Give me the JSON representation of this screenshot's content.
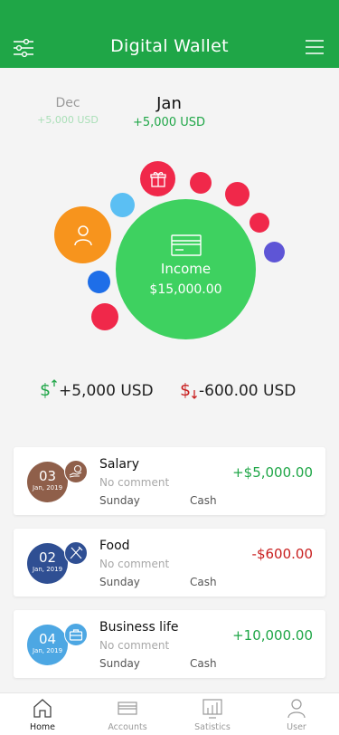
{
  "header": {
    "title": "Digital Wallet"
  },
  "months": {
    "prev": {
      "name": "Dec",
      "amount": "+5,000 USD"
    },
    "current": {
      "name": "Jan",
      "amount": "+5,000 USD"
    }
  },
  "main_bubble": {
    "label": "Income",
    "value": "$15,000.00"
  },
  "summary": {
    "income": "+5,000 USD",
    "expense": "-600.00 USD"
  },
  "transactions": [
    {
      "day": "03",
      "date_sub": "Jan, 2019",
      "category": "Salary",
      "comment": "No comment",
      "weekday": "Sunday",
      "method": "Cash",
      "amount": "+$5,000.00",
      "color": "#8f5f4a",
      "icon": "money-hand-icon",
      "amount_color": "#1fa647"
    },
    {
      "day": "02",
      "date_sub": "Jan, 2019",
      "category": "Food",
      "comment": "No comment",
      "weekday": "Sunday",
      "method": "Cash",
      "amount": "-$600.00",
      "color": "#2f4f93",
      "icon": "utensils-icon",
      "amount_color": "#c81e1e"
    },
    {
      "day": "04",
      "date_sub": "Jan, 2019",
      "category": "Business life",
      "comment": "No comment",
      "weekday": "Sunday",
      "method": "Cash",
      "amount": "+10,000.00",
      "color": "#4da7e3",
      "icon": "briefcase-icon",
      "amount_color": "#1fa647"
    }
  ],
  "tabs": [
    {
      "label": "Home",
      "icon": "home-icon"
    },
    {
      "label": "Accounts",
      "icon": "card-icon"
    },
    {
      "label": "Satistics",
      "icon": "chart-icon"
    },
    {
      "label": "User",
      "icon": "user-icon"
    }
  ],
  "colors": {
    "brand": "#1fa647",
    "income_bubble": "#3ed160",
    "expense": "#c81e1e",
    "bubble_orange": "#f7941d",
    "bubble_red": "#f0284a",
    "bubble_blue": "#1e6ee8",
    "bubble_lightblue": "#5bbff3",
    "bubble_purple": "#5e55d6"
  }
}
